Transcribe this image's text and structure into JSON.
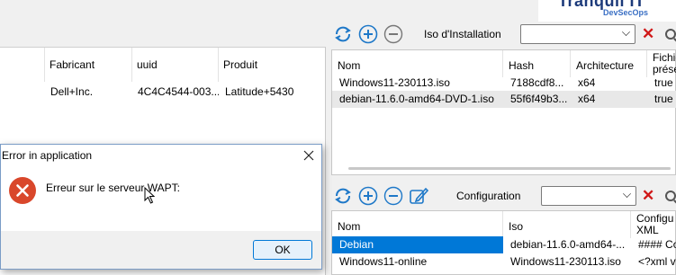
{
  "logo": {
    "brand": "Tranquil IT",
    "tagline": "DevSecOps"
  },
  "left_grid": {
    "columns": [
      "Fabricant",
      "uuid",
      "Produit"
    ],
    "rows": [
      [
        "Dell+Inc.",
        "4C4C4544-003...",
        "Latitude+5430"
      ]
    ]
  },
  "iso_toolbar": {
    "label": "Iso d'Installation",
    "selected": ""
  },
  "iso_grid": {
    "columns": [
      "Nom",
      "Hash",
      "Architecture",
      "Fichier présent"
    ],
    "column4_lines": [
      "Fichie",
      "prése"
    ],
    "rows": [
      [
        "Windows11-230113.iso",
        "7188cdf8...",
        "x64",
        "true"
      ],
      [
        "debian-11.6.0-amd64-DVD-1.iso",
        "55f6f49b3...",
        "x64",
        "true"
      ]
    ]
  },
  "config_toolbar": {
    "label": "Configuration",
    "selected": ""
  },
  "config_grid": {
    "columns": [
      "Nom",
      "Iso",
      "Configuration XML"
    ],
    "column3_lines": [
      "Configu",
      "XML"
    ],
    "rows": [
      [
        "Debian",
        "debian-11.6.0-amd64-...",
        "#### Co"
      ],
      [
        "Windows11-online",
        "Windows11-230113.iso",
        "<?xml v"
      ]
    ]
  },
  "dialog": {
    "title": "Error in application",
    "message": "Erreur sur le serveur WAPT:",
    "ok_label": "OK"
  },
  "colors": {
    "accent": "#0078d7",
    "selection": "#0078d7",
    "error": "#d9472b",
    "delete": "#d01818",
    "icon_blue": "#1e78c8"
  },
  "icons": [
    "refresh-icon",
    "add-icon",
    "remove-icon",
    "edit-icon",
    "delete-icon",
    "search-icon",
    "error-icon",
    "close-icon",
    "chevron-down-icon"
  ]
}
